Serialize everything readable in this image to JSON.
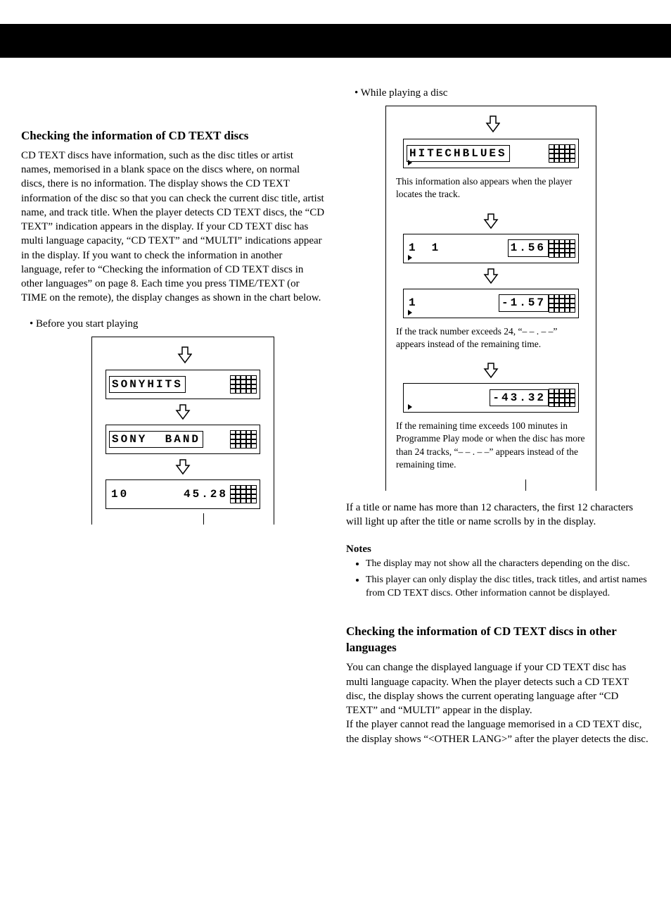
{
  "left": {
    "heading": "Checking the information of CD TEXT discs",
    "para": "CD TEXT discs have information, such as the disc titles or artist names, memorised in a blank space on the discs where, on normal discs, there is no information. The display shows the CD TEXT information of the disc so that you can check the current disc title, artist name, and track title. When the player detects CD TEXT discs, the “CD TEXT” indication appears in the display. If your CD TEXT disc has multi language capacity, “CD TEXT” and “MULTI” indications appear in the display. If you want to check the information in another language, refer to “Checking the information of CD TEXT discs in other languages” on page 8. Each time you press TIME/TEXT (or TIME on the remote), the display changes as shown in the chart below.",
    "bullet": "Before you start playing",
    "displays": [
      {
        "segments": [
          "SONYHITS"
        ],
        "boxed": true
      },
      {
        "segments": [
          "SONY",
          "BAND"
        ],
        "boxed": true
      },
      {
        "segments": [
          "10",
          "45.28"
        ],
        "boxed": false
      }
    ]
  },
  "right": {
    "bullet": "While playing a disc",
    "displays1": [
      {
        "segments": [
          "HITECHBLUES"
        ],
        "boxed": true,
        "wide": true
      }
    ],
    "note1": "This information also appears when the player locates the track.",
    "displays2": [
      {
        "segments": [
          "1",
          "1",
          "1.56"
        ],
        "boxed": [
          false,
          false,
          true
        ]
      },
      {
        "segments": [
          "1",
          "-1.57"
        ],
        "boxed": [
          false,
          true
        ]
      }
    ],
    "note2": "If the track number exceeds 24, “– – . – –” appears instead of the remaining time.",
    "displays3": [
      {
        "segments": [
          "-43.32"
        ],
        "boxed": [
          true
        ],
        "rightAlign": true
      }
    ],
    "note3": "If the remaining time exceeds 100 minutes in Programme Play mode or when the disc has more than 24 tracks, “– – . – –” appears instead of the remaining time.",
    "para2": "If a title or name has more than 12 characters, the first 12 characters will light up after the title or name scrolls by in the display.",
    "notes_heading": "Notes",
    "notes": [
      "The display may not show all the characters depending on the disc.",
      "This player can only display the disc titles, track titles, and artist names from CD TEXT discs. Other information cannot be displayed."
    ],
    "sect2_heading": "Checking the information of CD TEXT discs in other languages",
    "sect2_para": "You can change the displayed language if your CD TEXT disc has multi language capacity. When the player detects such a CD TEXT disc, the display shows the current operating language after “CD TEXT” and “MULTI” appear in the display.\nIf the player cannot read the language memorised in a CD TEXT disc, the display shows “<OTHER LANG>” after the player detects the disc."
  }
}
